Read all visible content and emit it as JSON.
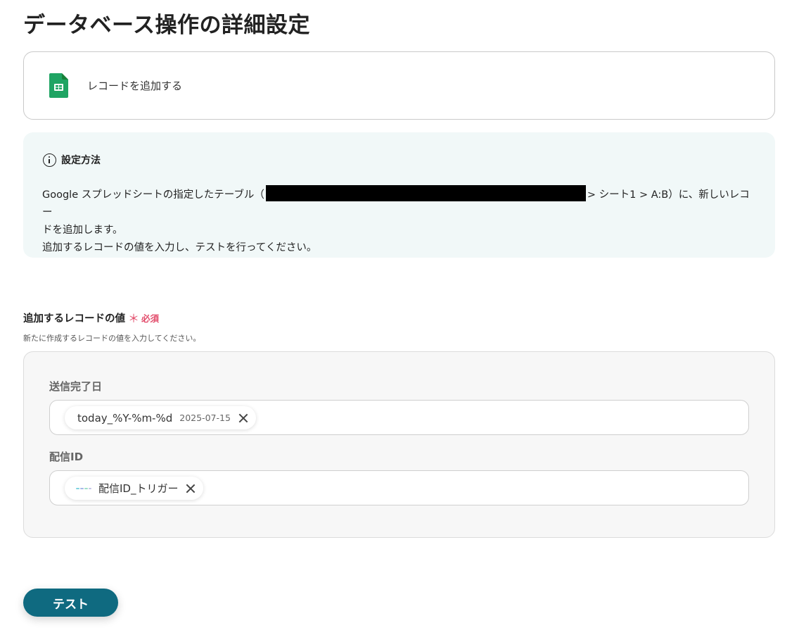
{
  "page": {
    "title": "データベース操作の詳細設定"
  },
  "action": {
    "label": "レコードを追加する",
    "icon": "google-sheets-icon"
  },
  "info": {
    "title": "設定方法",
    "line1_before": "Google スプレッドシートの指定したテーブル（",
    "line1_after": "> シート1 > A:B）に、新しいレコー",
    "line2": "ドを追加します。",
    "line3": "追加するレコードの値を入力し、テストを行ってください。"
  },
  "field": {
    "label": "追加するレコードの値",
    "required_mark": "＊",
    "required_text": "必須",
    "description": "新たに作成するレコードの値を入力してください。"
  },
  "columns": [
    {
      "label": "送信完了日",
      "chip": "today_%Y-%m-%d",
      "chip_sub": "2025-07-15"
    },
    {
      "label": "配信ID",
      "chip": "配信ID_トリガー",
      "chip_icon": "yoom-logo-icon"
    }
  ],
  "test_button": {
    "label": "テスト",
    "color": "#0f6a80"
  }
}
